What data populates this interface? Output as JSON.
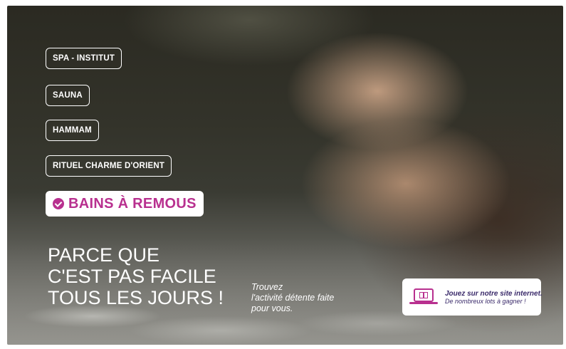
{
  "menu": {
    "items": [
      {
        "label": "SPA - INSTITUT"
      },
      {
        "label": "SAUNA"
      },
      {
        "label": "HAMMAM"
      },
      {
        "label": "RITUEL CHARME D'ORIENT"
      }
    ],
    "active": {
      "label": "BAINS À REMOUS",
      "icon": "check-circle-icon"
    }
  },
  "headline": {
    "lines": [
      "PARCE QUE",
      "C'EST PAS FACILE",
      "TOUS LES JOURS !"
    ]
  },
  "tagline": {
    "lines": [
      "Trouvez",
      "l'activité détente faite",
      "pour vous."
    ]
  },
  "promo": {
    "title": "Jouez sur notre site internet.",
    "subtitle": "De nombreux lots à gagner !",
    "icon": "laptop-gift-icon"
  },
  "colors": {
    "accent": "#b8308f",
    "promo_text": "#3a2a6a"
  }
}
